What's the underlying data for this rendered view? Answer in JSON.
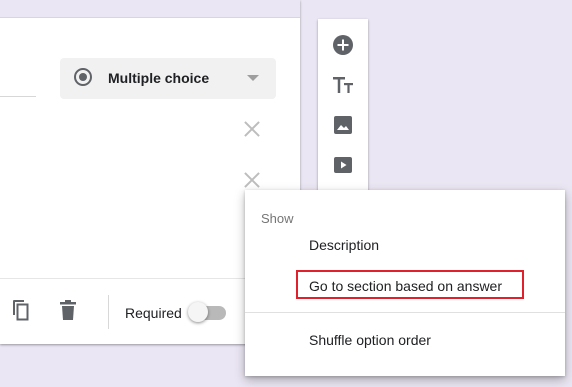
{
  "question_card": {
    "type_select": {
      "selected": "Multiple choice"
    },
    "footer": {
      "required_label": "Required",
      "required_on": false
    }
  },
  "toolbar": {
    "buttons": [
      "add-question-icon",
      "title-text-icon",
      "image-icon",
      "video-icon"
    ]
  },
  "menu": {
    "header": "Show",
    "items": [
      "Description",
      "Go to section based on answer",
      "Shuffle option order"
    ],
    "highlighted_item": "Go to section based on answer"
  },
  "colors": {
    "background": "#ebe6f3",
    "highlight": "#e0202a",
    "icon": "#5f6368"
  }
}
